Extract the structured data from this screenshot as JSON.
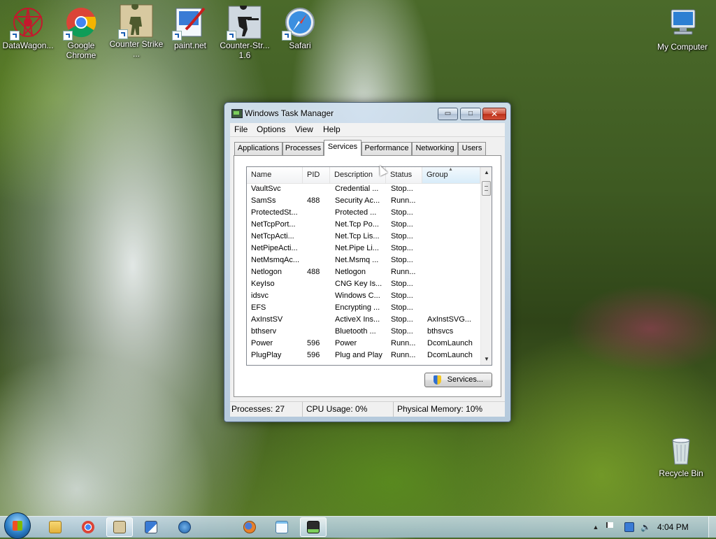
{
  "desktop_icons": [
    {
      "label": "DataWagon...",
      "icon": "datawagon-icon"
    },
    {
      "label": "Google Chrome",
      "icon": "chrome-icon"
    },
    {
      "label": "Counter Strike ...",
      "icon": "counter-strike-icon"
    },
    {
      "label": "paint.net",
      "icon": "paint-net-icon"
    },
    {
      "label": "Counter-Str... 1.6",
      "icon": "counter-strike-16-icon"
    },
    {
      "label": "Safari",
      "icon": "safari-icon"
    },
    {
      "label": "My Computer",
      "icon": "my-computer-icon"
    },
    {
      "label": "Recycle Bin",
      "icon": "recycle-bin-icon"
    }
  ],
  "window": {
    "title": "Windows Task Manager",
    "caption_buttons": {
      "minimize": "▭",
      "maximize": "□",
      "close": "✕"
    },
    "menu": [
      "File",
      "Options",
      "View",
      "Help"
    ],
    "tabs": [
      "Applications",
      "Processes",
      "Services",
      "Performance",
      "Networking",
      "Users"
    ],
    "active_tab": "Services",
    "columns": [
      "Name",
      "PID",
      "Description",
      "Status",
      "Group"
    ],
    "sorted_column": "Group",
    "rows": [
      {
        "name": "VaultSvc",
        "pid": "",
        "description": "Credential ...",
        "status": "Stop...",
        "group": ""
      },
      {
        "name": "SamSs",
        "pid": "488",
        "description": "Security Ac...",
        "status": "Runn...",
        "group": ""
      },
      {
        "name": "ProtectedSt...",
        "pid": "",
        "description": "Protected ...",
        "status": "Stop...",
        "group": ""
      },
      {
        "name": "NetTcpPort...",
        "pid": "",
        "description": "Net.Tcp Po...",
        "status": "Stop...",
        "group": ""
      },
      {
        "name": "NetTcpActi...",
        "pid": "",
        "description": "Net.Tcp Lis...",
        "status": "Stop...",
        "group": ""
      },
      {
        "name": "NetPipeActi...",
        "pid": "",
        "description": "Net.Pipe Li...",
        "status": "Stop...",
        "group": ""
      },
      {
        "name": "NetMsmqAc...",
        "pid": "",
        "description": "Net.Msmq ...",
        "status": "Stop...",
        "group": ""
      },
      {
        "name": "Netlogon",
        "pid": "488",
        "description": "Netlogon",
        "status": "Runn...",
        "group": ""
      },
      {
        "name": "KeyIso",
        "pid": "",
        "description": "CNG Key Is...",
        "status": "Stop...",
        "group": ""
      },
      {
        "name": "idsvc",
        "pid": "",
        "description": "Windows C...",
        "status": "Stop...",
        "group": ""
      },
      {
        "name": "EFS",
        "pid": "",
        "description": "Encrypting ...",
        "status": "Stop...",
        "group": ""
      },
      {
        "name": "AxInstSV",
        "pid": "",
        "description": "ActiveX Ins...",
        "status": "Stop...",
        "group": "AxInstSVG..."
      },
      {
        "name": "bthserv",
        "pid": "",
        "description": "Bluetooth ...",
        "status": "Stop...",
        "group": "bthsvcs"
      },
      {
        "name": "Power",
        "pid": "596",
        "description": "Power",
        "status": "Runn...",
        "group": "DcomLaunch"
      },
      {
        "name": "PlugPlay",
        "pid": "596",
        "description": "Plug and Play",
        "status": "Runn...",
        "group": "DcomLaunch"
      }
    ],
    "services_button": "Services...",
    "status": {
      "processes": "Processes: 27",
      "cpu": "CPU Usage: 0%",
      "memory": "Physical Memory: 10%"
    }
  },
  "taskbar": {
    "pinned": [
      "explorer-icon",
      "chrome-icon",
      "counter-strike-icon",
      "paint-net-icon",
      "network-icon",
      "firefox-icon",
      "notepad-icon",
      "task-manager-icon"
    ],
    "active": [
      "counter-strike-icon",
      "task-manager-icon"
    ],
    "clock": "4:04 PM"
  },
  "colors": {
    "window_frame": "#c8d8ea",
    "close_button": "#c9402a",
    "selection_header": "#d8ecf9"
  }
}
